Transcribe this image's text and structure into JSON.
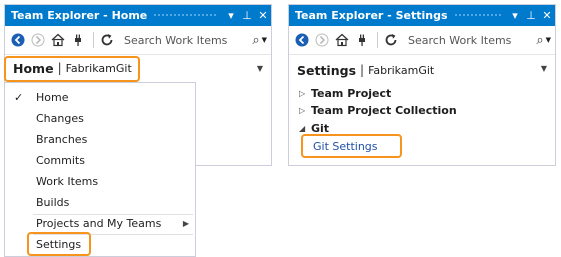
{
  "left": {
    "title": "Team Explorer - Home",
    "title_buttons": [
      "▾",
      "⊥",
      "✕"
    ],
    "search_placeholder": "Search Work Items",
    "header_title": "Home",
    "header_sub": "FabrikamGit",
    "menu": {
      "items": [
        {
          "label": "Home",
          "checked": true
        },
        {
          "label": "Changes"
        },
        {
          "label": "Branches"
        },
        {
          "label": "Commits"
        },
        {
          "label": "Work Items"
        },
        {
          "label": "Builds"
        },
        {
          "label": "Projects and My Teams",
          "has_submenu": true
        },
        {
          "label": "Settings"
        }
      ],
      "check_glyph": "✓",
      "submenu_glyph": "▶"
    }
  },
  "right": {
    "title": "Team Explorer - Settings",
    "title_buttons": [
      "▾",
      "⊥",
      "✕"
    ],
    "search_placeholder": "Search Work Items",
    "header_title": "Settings",
    "header_sub": "FabrikamGit",
    "sections": [
      {
        "label": "Team Project",
        "expanded": false
      },
      {
        "label": "Team Project Collection",
        "expanded": false
      },
      {
        "label": "Git",
        "expanded": true
      }
    ],
    "git_link": "Git Settings"
  },
  "colors": {
    "titlebar": "#007acc",
    "highlight": "#f7941d",
    "link": "#1e4fa8"
  },
  "icons": [
    "back-icon",
    "forward-icon",
    "home-icon",
    "connect-icon",
    "refresh-icon",
    "search-icon"
  ]
}
